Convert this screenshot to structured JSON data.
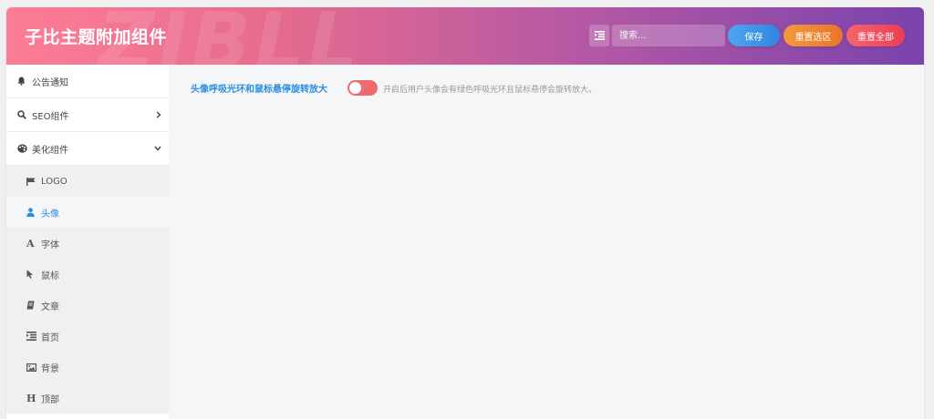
{
  "header": {
    "title": "子比主题附加组件",
    "watermark": "ZIBLL",
    "search": {
      "placeholder": "搜索..."
    },
    "buttons": {
      "save": "保存",
      "reset_section": "重置选区",
      "reset_all": "重置全部"
    }
  },
  "sidebar": {
    "items": [
      {
        "label": "公告通知",
        "icon": "bell-icon"
      },
      {
        "label": "SEO组件",
        "icon": "search-icon",
        "caret": "chevron-right-icon"
      },
      {
        "label": "美化组件",
        "icon": "palette-icon",
        "caret": "chevron-down-icon",
        "expanded": true
      }
    ],
    "sub_items": [
      {
        "label": "LOGO",
        "icon": "flag-icon"
      },
      {
        "label": "头像",
        "icon": "user-icon",
        "active": true
      },
      {
        "label": "字体",
        "icon": "font-icon"
      },
      {
        "label": "鼠标",
        "icon": "cursor-icon"
      },
      {
        "label": "文章",
        "icon": "book-icon"
      },
      {
        "label": "首页",
        "icon": "list-icon"
      },
      {
        "label": "背景",
        "icon": "image-icon"
      },
      {
        "label": "顶部",
        "icon": "heading-icon"
      }
    ]
  },
  "content": {
    "option": {
      "label": "头像呼吸光环和鼠标悬停旋转放大",
      "enabled": false,
      "description": "开启后用户头像会有绿色呼吸光环且鼠标悬停会旋转放大。"
    }
  },
  "colors": {
    "header_gradient_start": "#fd7d96",
    "header_gradient_end": "#7a43ad",
    "accent_blue": "#2b8fe0",
    "toggle_off": "#ef6a6c"
  }
}
